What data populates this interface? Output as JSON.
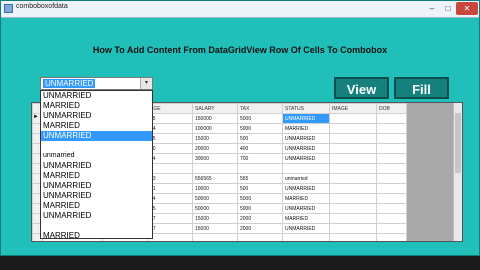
{
  "window": {
    "title": "comboboxofdata",
    "min_glyph": "–",
    "max_glyph": "□",
    "close_glyph": "✕"
  },
  "heading": "How To Add Content From DataGridView Row Of Cells To Combobox",
  "combo": {
    "selected": "UNMARRIED",
    "arrow_glyph": "▾"
  },
  "buttons": {
    "view": "View",
    "fill": "Fill"
  },
  "grid": {
    "columns": [
      "",
      "",
      "NDER",
      "AGE",
      "SALARY",
      "TAX",
      "STATUS",
      "IMAGE",
      "DOB"
    ],
    "row_arrow": "►",
    "rows": [
      [
        "",
        "",
        "ALE",
        "25",
        "150000",
        "5000",
        "UNMARRIED",
        "",
        ""
      ],
      [
        "",
        "",
        "ALE",
        "24",
        "100000",
        "5000",
        "MARRIED",
        "",
        ""
      ],
      [
        "",
        "",
        "E",
        "25",
        "15000",
        "500",
        "UNMARRIED",
        "",
        ""
      ],
      [
        "",
        "",
        "ALE",
        "30",
        "20000",
        "400",
        "UNMARRIED",
        "",
        ""
      ],
      [
        "",
        "",
        "E",
        "34",
        "30000",
        "700",
        "UNMARRIED",
        "",
        ""
      ],
      [
        "",
        "",
        "",
        "",
        "",
        "",
        "",
        "",
        ""
      ],
      [
        "",
        "",
        "",
        "43",
        "556565",
        "565",
        "unmarried",
        "",
        ""
      ],
      [
        "",
        "",
        "E",
        "21",
        "10000",
        "500",
        "UNMARRIED",
        "",
        ""
      ],
      [
        "",
        "",
        "ALE",
        "24",
        "50000",
        "5000",
        "MARRIED",
        "",
        ""
      ],
      [
        "",
        "",
        "E",
        "25",
        "50000",
        "5000",
        "UNMARRIED",
        "",
        ""
      ],
      [
        "",
        "",
        "E",
        "27",
        "15000",
        "2000",
        "MARRIED",
        "",
        ""
      ],
      [
        "",
        "",
        "E",
        "27",
        "15000",
        "2000",
        "UNMARRIED",
        "",
        ""
      ],
      [
        "",
        "",
        "",
        "",
        "",
        "",
        "",
        "",
        ""
      ]
    ]
  },
  "dropdown": {
    "items": [
      "UNMARRIED",
      "MARRIED",
      "UNMARRIED",
      "MARRIED",
      "UNMARRIED",
      "",
      "unmarried",
      "UNMARRIED",
      "MARRIED",
      "UNMARRIED",
      "UNMARRIED",
      "MARRIED",
      "UNMARRIED",
      "",
      "MARRIED",
      "UNMARRIED"
    ],
    "highlighted_index": 4
  }
}
